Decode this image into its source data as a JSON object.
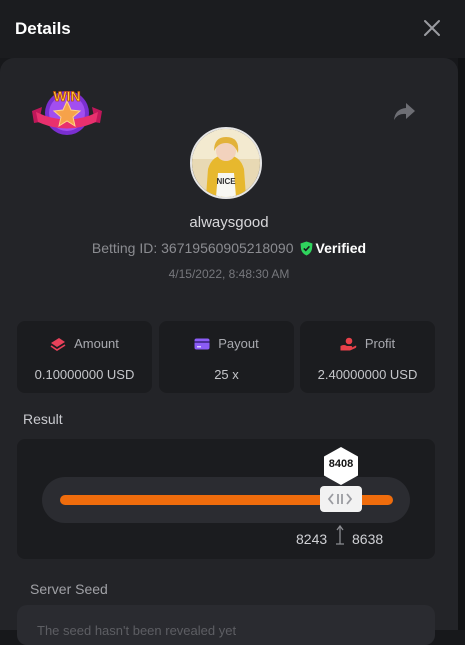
{
  "header": {
    "title": "Details"
  },
  "user": {
    "name": "alwaysgood",
    "betting_id_label": "Betting ID:",
    "betting_id": "36719560905218090",
    "verified_label": "Verified",
    "date": "4/15/2022, 8:48:30 AM",
    "badge_text": "WIN",
    "avatar_shirt_text": "NICE"
  },
  "stats": [
    {
      "label": "Amount",
      "value": "0.10000000 USD",
      "icon": "money-icon"
    },
    {
      "label": "Payout",
      "value": "25 x",
      "icon": "wallet-icon"
    },
    {
      "label": "Profit",
      "value": "2.40000000 USD",
      "icon": "hand-coin-icon"
    }
  ],
  "result": {
    "section_label": "Result",
    "value": "8408",
    "range_low": "8243",
    "range_high": "8638",
    "slider_min": 0,
    "slider_max": 10000
  },
  "server_seed": {
    "label": "Server Seed",
    "text": "The seed hasn't been revealed yet"
  },
  "colors": {
    "accent": "#ef6c0c",
    "verified_green": "#2fd45d",
    "payout_purple": "#8b5cf6",
    "profit_red": "#e8414a",
    "amount_pink": "#e8415a"
  }
}
